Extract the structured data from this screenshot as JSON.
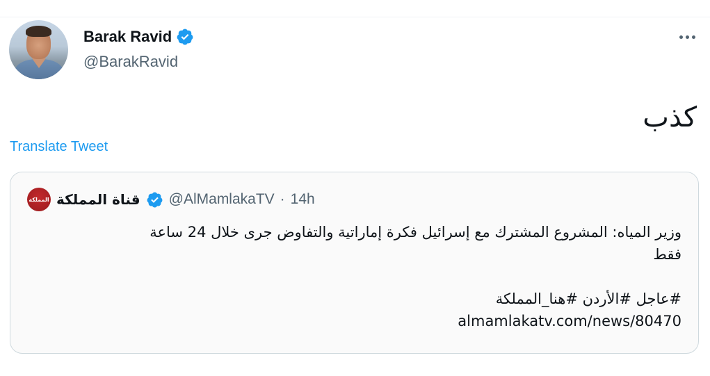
{
  "tweet": {
    "author": {
      "display_name": "Barak Ravid",
      "handle": "@BarakRavid",
      "verified_icon": "verified-badge-icon",
      "avatar": "profile-photo"
    },
    "more_icon": "more-options-icon",
    "text": "كذب",
    "translate_label": "Translate Tweet"
  },
  "quoted_tweet": {
    "author": {
      "display_name": "قناة المملكة",
      "handle": "@AlMamlakaTV",
      "verified_icon": "verified-badge-icon",
      "avatar_text": "المملكة"
    },
    "separator": "·",
    "time": "14h",
    "lines": [
      "وزير المياه: المشروع المشترك مع إسرائيل فكرة إماراتية والتفاوض جرى خلال 24 ساعة",
      "فقط",
      "#عاجل #الأردن #هنا_المملكة",
      "almamlakatv.com/news/80470"
    ]
  },
  "colors": {
    "accent": "#1d9bf0",
    "text_primary": "#0f1419",
    "text_secondary": "#536471",
    "border": "#cfd9de"
  }
}
